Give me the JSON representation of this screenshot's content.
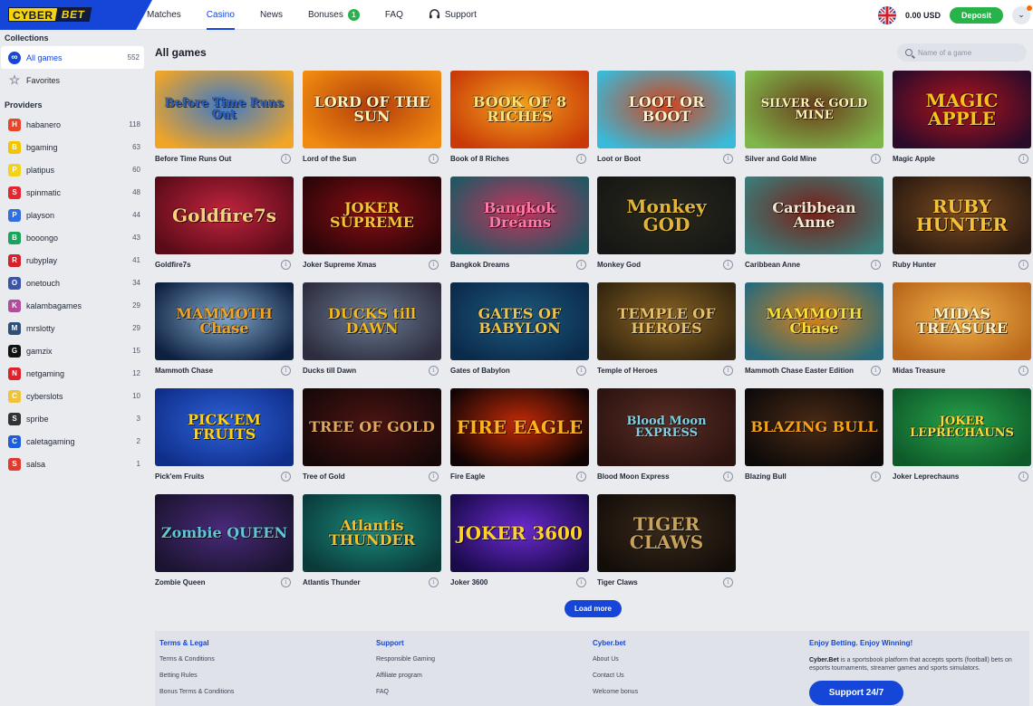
{
  "header": {
    "logo_left": "CYBER",
    "logo_right": "BET",
    "nav": [
      {
        "label": "Matches"
      },
      {
        "label": "Casino"
      },
      {
        "label": "News"
      },
      {
        "label": "Bonuses",
        "badge": "1"
      },
      {
        "label": "FAQ"
      },
      {
        "label": "Support"
      }
    ],
    "active_nav": "Casino",
    "balance": "0.00 USD",
    "deposit_label": "Deposit"
  },
  "sidebar": {
    "collections_heading": "Collections",
    "collections": [
      {
        "label": "All games",
        "count": "552",
        "icon": "infinity-icon",
        "active": true
      },
      {
        "label": "Favorites",
        "count": "",
        "icon": "star-icon",
        "active": false
      }
    ],
    "providers_heading": "Providers",
    "providers": [
      {
        "label": "habanero",
        "count": "118",
        "icon": "habanero-logo",
        "color": "#e8462b"
      },
      {
        "label": "bgaming",
        "count": "63",
        "icon": "bgaming-logo",
        "color": "#f5c400"
      },
      {
        "label": "platipus",
        "count": "60",
        "icon": "platipus-logo",
        "color": "#f2d21b"
      },
      {
        "label": "spinmatic",
        "count": "48",
        "icon": "spinmatic-logo",
        "color": "#e3262f"
      },
      {
        "label": "playson",
        "count": "44",
        "icon": "playson-logo",
        "color": "#2f6fe0"
      },
      {
        "label": "booongo",
        "count": "43",
        "icon": "booongo-logo",
        "color": "#1aa35b"
      },
      {
        "label": "rubyplay",
        "count": "41",
        "icon": "rubyplay-logo",
        "color": "#d6202a"
      },
      {
        "label": "onetouch",
        "count": "34",
        "icon": "onetouch-logo",
        "color": "#3a55a8"
      },
      {
        "label": "kalambagames",
        "count": "29",
        "icon": "kalamba-logo",
        "color": "#b24d9c"
      },
      {
        "label": "mrslotty",
        "count": "29",
        "icon": "mrslotty-logo",
        "color": "#2d4f7a"
      },
      {
        "label": "gamzix",
        "count": "15",
        "icon": "gamzix-logo",
        "color": "#111111"
      },
      {
        "label": "netgaming",
        "count": "12",
        "icon": "netgaming-logo",
        "color": "#e0212a"
      },
      {
        "label": "cyberslots",
        "count": "10",
        "icon": "cyberslots-logo",
        "color": "#f0c43a"
      },
      {
        "label": "spribe",
        "count": "3",
        "icon": "spribe-logo",
        "color": "#333333"
      },
      {
        "label": "caletagaming",
        "count": "2",
        "icon": "caleta-logo",
        "color": "#1e5fd8"
      },
      {
        "label": "salsa",
        "count": "1",
        "icon": "salsa-logo",
        "color": "#e33a2c"
      }
    ]
  },
  "main": {
    "title": "All games",
    "search_placeholder": "Name of a game",
    "load_more": "Load more",
    "games": [
      {
        "name": "Before Time Runs Out",
        "art": "Before Time Runs Out",
        "bg1": "#f0a526",
        "bg2": "#3d79c9",
        "fg": "#2b5fc0"
      },
      {
        "name": "Lord of the Sun",
        "art": "LORD OF THE SUN",
        "bg1": "#f08a10",
        "bg2": "#b23d0a",
        "fg": "#fff3c0"
      },
      {
        "name": "Book of 8 Riches",
        "art": "BOOK OF 8 RICHES",
        "bg1": "#c93a08",
        "bg2": "#f2a21b",
        "fg": "#fde27a"
      },
      {
        "name": "Loot or Boot",
        "art": "LOOT OR BOOT",
        "bg1": "#3ab9d8",
        "bg2": "#d44218",
        "fg": "#fff1c7"
      },
      {
        "name": "Silver and Gold Mine",
        "art": "SILVER & GOLD MINE",
        "bg1": "#7fb54a",
        "bg2": "#6a3d1a",
        "fg": "#fff0b0"
      },
      {
        "name": "Magic Apple",
        "art": "MAGIC APPLE",
        "bg1": "#2a0b2a",
        "bg2": "#b2141c",
        "fg": "#f5c21b"
      },
      {
        "name": "Goldfire7s",
        "art": "Goldfire7s",
        "bg1": "#5a0b18",
        "bg2": "#c1243e",
        "fg": "#f8d27c"
      },
      {
        "name": "Joker Supreme Xmas",
        "art": "JOKER SUPREME",
        "bg1": "#2a0508",
        "bg2": "#8a0e14",
        "fg": "#f3c43a"
      },
      {
        "name": "Bangkok Dreams",
        "art": "Bangkok Dreams",
        "bg1": "#1f5763",
        "bg2": "#c6345c",
        "fg": "#ff7aa8"
      },
      {
        "name": "Monkey God",
        "art": "Monkey GOD",
        "bg1": "#161616",
        "bg2": "#2a2a1a",
        "fg": "#e2b53a"
      },
      {
        "name": "Caribbean Anne",
        "art": "Caribbean Anne",
        "bg1": "#3b7b78",
        "bg2": "#7a1d15",
        "fg": "#f4ead4"
      },
      {
        "name": "Ruby Hunter",
        "art": "RUBY HUNTER",
        "bg1": "#2a1a10",
        "bg2": "#7a4a20",
        "fg": "#f6c13a"
      },
      {
        "name": "Mammoth Chase",
        "art": "MAMMOTH Chase",
        "bg1": "#0e2040",
        "bg2": "#7fa6c9",
        "fg": "#f2a420"
      },
      {
        "name": "Ducks till Dawn",
        "art": "DUCKS till DAWN",
        "bg1": "#2d2d3e",
        "bg2": "#6a7a92",
        "fg": "#f2b81c"
      },
      {
        "name": "Gates of Babylon",
        "art": "GATES OF BABYLON",
        "bg1": "#0a2a4a",
        "bg2": "#1e5a7e",
        "fg": "#f0c44a"
      },
      {
        "name": "Temple of Heroes",
        "art": "TEMPLE OF HEROES",
        "bg1": "#33250f",
        "bg2": "#8a6424",
        "fg": "#e6c06a"
      },
      {
        "name": "Mammoth Chase Easter Edition",
        "art": "MAMMOTH Chase",
        "bg1": "#2a6a7a",
        "bg2": "#d8801a",
        "fg": "#f6e03a"
      },
      {
        "name": "Midas Treasure",
        "art": "MIDAS TREASURE",
        "bg1": "#b9661a",
        "bg2": "#f0b24a",
        "fg": "#fff2c6"
      },
      {
        "name": "Pick'em Fruits",
        "art": "PICK'EM FRUITS",
        "bg1": "#0f2e8a",
        "bg2": "#2e62d8",
        "fg": "#ffd21a"
      },
      {
        "name": "Tree of Gold",
        "art": "TREE OF GOLD",
        "bg1": "#170808",
        "bg2": "#4a1412",
        "fg": "#e0a860"
      },
      {
        "name": "Fire Eagle",
        "art": "FIRE EAGLE",
        "bg1": "#100404",
        "bg2": "#c22a08",
        "fg": "#ffb21a"
      },
      {
        "name": "Blood Moon Express",
        "art": "Blood Moon EXPRESS",
        "bg1": "#2b1310",
        "bg2": "#5a2d24",
        "fg": "#7fd0e0"
      },
      {
        "name": "Blazing Bull",
        "art": "BLAZING BULL",
        "bg1": "#0d0a0a",
        "bg2": "#4a2a14",
        "fg": "#f4a21a"
      },
      {
        "name": "Joker Leprechauns",
        "art": "JOKER LEPRECHAUNS",
        "bg1": "#0e5a2a",
        "bg2": "#27a24a",
        "fg": "#ffd93a"
      },
      {
        "name": "Zombie Queen",
        "art": "Zombie QUEEN",
        "bg1": "#1b1430",
        "bg2": "#4a2a7a",
        "fg": "#5fc7d6"
      },
      {
        "name": "Atlantis Thunder",
        "art": "Atlantis THUNDER",
        "bg1": "#0a3a3a",
        "bg2": "#1a8a7a",
        "fg": "#f4c02a"
      },
      {
        "name": "Joker 3600",
        "art": "JOKER 3600",
        "bg1": "#1a0a4a",
        "bg2": "#6a2ad0",
        "fg": "#ffd12a"
      },
      {
        "name": "Tiger Claws",
        "art": "TIGER CLAWS",
        "bg1": "#130d0a",
        "bg2": "#3a2a1a",
        "fg": "#c8a25a"
      }
    ]
  },
  "footer": {
    "col1": {
      "heading": "Terms & Legal",
      "links": [
        "Terms & Conditions",
        "Betting Rules",
        "Bonus Terms & Conditions"
      ]
    },
    "col2": {
      "heading": "Support",
      "links": [
        "Responsible Gaming",
        "Affiliate program",
        "FAQ"
      ]
    },
    "col3": {
      "heading": "Cyber.bet",
      "links": [
        "About Us",
        "Contact Us",
        "Welcome bonus"
      ]
    },
    "col4": {
      "heading": "Enjoy Betting. Enjoy Winning!",
      "brand": "Cyber.Bet",
      "text": " is a sportsbook platform that accepts sports (football) bets on esports tournaments, streamer games and sports simulators."
    },
    "support_button": "Support 24/7"
  },
  "colors": {
    "brand_blue": "#1546d8",
    "deposit_green": "#27b24a",
    "logo_yellow": "#f7d40a"
  }
}
